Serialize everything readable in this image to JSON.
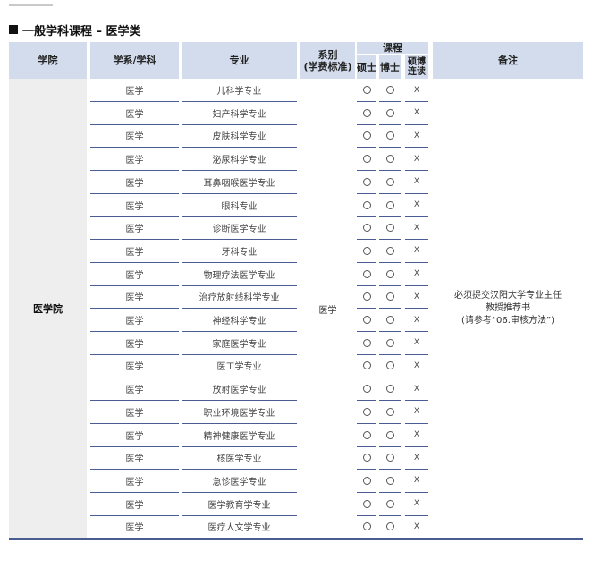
{
  "section_title": "一般学科课程 – 医学类",
  "headers": {
    "college": "学院",
    "subject": "学系/学科",
    "major": "专业",
    "department": "系别\n(学费标准)",
    "course": "课程",
    "masters": "硕士",
    "doctoral": "博士",
    "integrated": "硕博\n连读",
    "note": "备注"
  },
  "college_name": "医学院",
  "department_value": "医学",
  "note_text": "必须提交汉阳大学专业主任\n教授推荐书\n(请参考“06.审核方法”)",
  "available_icon": "circle-icon",
  "unavailable_mark": "X",
  "rows": [
    {
      "subject": "医学",
      "major": "儿科学专业"
    },
    {
      "subject": "医学",
      "major": "妇产科学专业"
    },
    {
      "subject": "医学",
      "major": "皮肤科学专业"
    },
    {
      "subject": "医学",
      "major": "泌尿科学专业"
    },
    {
      "subject": "医学",
      "major": "耳鼻咽喉医学专业"
    },
    {
      "subject": "医学",
      "major": "眼科专业"
    },
    {
      "subject": "医学",
      "major": "诊断医学专业"
    },
    {
      "subject": "医学",
      "major": "牙科专业"
    },
    {
      "subject": "医学",
      "major": "物理疗法医学专业"
    },
    {
      "subject": "医学",
      "major": "治疗放射线科学专业"
    },
    {
      "subject": "医学",
      "major": "神经科学专业"
    },
    {
      "subject": "医学",
      "major": "家庭医学专业"
    },
    {
      "subject": "医学",
      "major": "医工学专业"
    },
    {
      "subject": "医学",
      "major": "放射医学专业"
    },
    {
      "subject": "医学",
      "major": "职业环境医学专业"
    },
    {
      "subject": "医学",
      "major": "精神健康医学专业"
    },
    {
      "subject": "医学",
      "major": "核医学专业"
    },
    {
      "subject": "医学",
      "major": "急诊医学专业"
    },
    {
      "subject": "医学",
      "major": "医学教育学专业"
    },
    {
      "subject": "医学",
      "major": "医疗人文学专业"
    }
  ],
  "colors": {
    "header_bg": "#d2dcec",
    "college_bg": "#eeeeee",
    "rule": "#4a5d92"
  }
}
